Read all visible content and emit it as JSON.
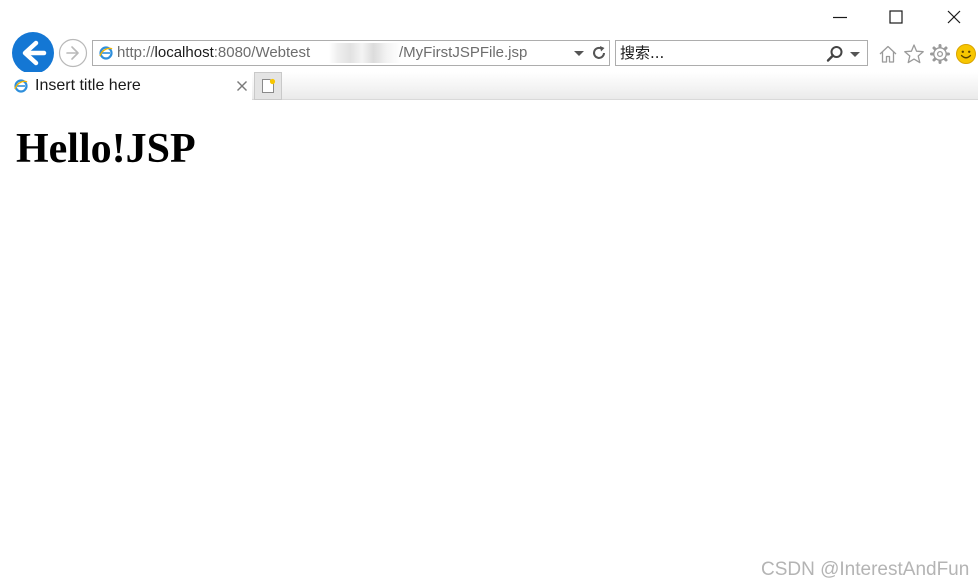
{
  "window": {
    "controls": [
      "minimize",
      "maximize",
      "close"
    ]
  },
  "navigation": {
    "back_icon": "back-arrow-icon",
    "forward_icon": "forward-arrow-icon",
    "address": {
      "favicon": "ie-favicon-icon",
      "scheme": "http://",
      "host": "localhost",
      "path_before_blur": ":8080/Webtest",
      "path_after_blur": "/MyFirstJSPFile.jsp"
    },
    "search": {
      "placeholder": "搜索..."
    },
    "tools": [
      "home-icon",
      "favorites-star-icon",
      "settings-gear-icon",
      "feedback-smiley-icon"
    ]
  },
  "tabs": [
    {
      "title": "Insert title here",
      "active": true
    }
  ],
  "page": {
    "heading": "Hello!JSP"
  },
  "watermark": "CSDN @InterestAndFun",
  "colors": {
    "back_button": "#1477d4",
    "accent_yellow": "#f7c600",
    "watermark": "#b4b4b4"
  }
}
